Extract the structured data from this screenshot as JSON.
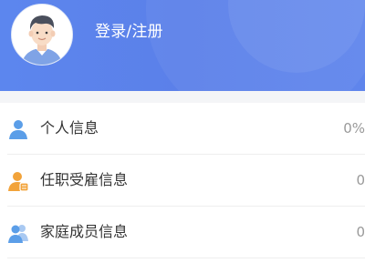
{
  "header": {
    "login_label": "登录/注册",
    "avatar_icon": "user-avatar-icon"
  },
  "menu": {
    "items": [
      {
        "label": "个人信息",
        "value": "0%",
        "icon": "person-icon",
        "icon_color": "#5b9ee8"
      },
      {
        "label": "任职受雇信息",
        "value": "0",
        "icon": "employee-badge-icon",
        "icon_color": "#f2a33a"
      },
      {
        "label": "家庭成员信息",
        "value": "0",
        "icon": "family-icon",
        "icon_color": "#5b9ee8"
      }
    ]
  },
  "colors": {
    "header_gradient_start": "#5c86ee",
    "header_gradient_end": "#5f85ec",
    "text_primary": "#333333",
    "text_secondary": "#999999"
  }
}
